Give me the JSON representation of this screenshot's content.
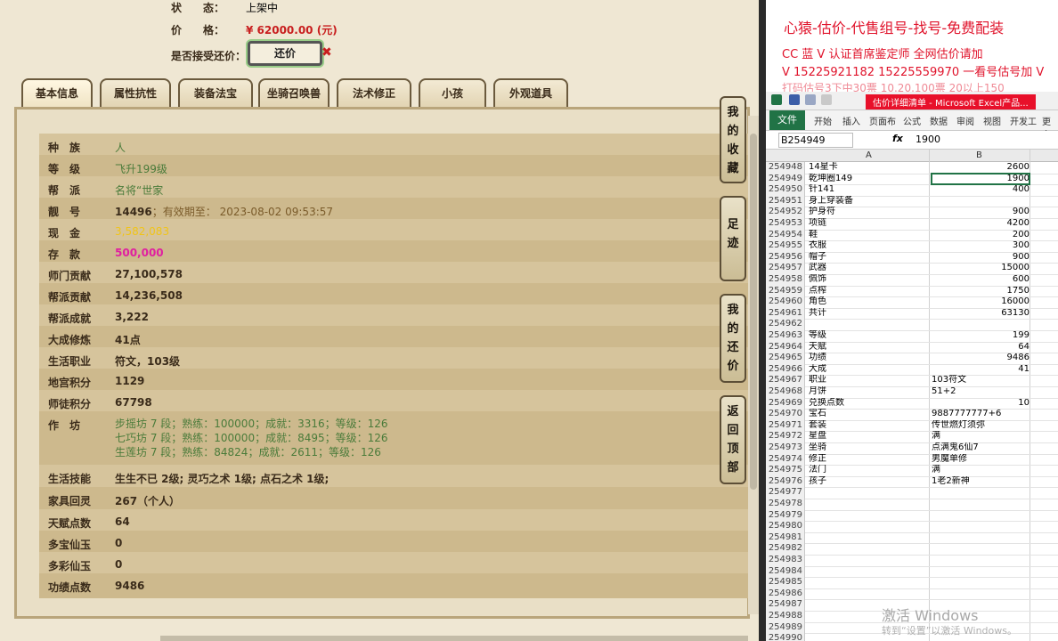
{
  "header": {
    "status_label": "状　　态：",
    "status_value": "上架中",
    "price_label": "价　　格：",
    "price_value": "¥ 62000.00 (元)",
    "bargain_label": "是否接受还价：",
    "bargain_button": "还价",
    "bargain_x": "✖"
  },
  "tabs": [
    "基本信息",
    "属性抗性",
    "装备法宝",
    "坐骑召唤兽",
    "法术修正",
    "小孩",
    "外观道具"
  ],
  "side_buttons": [
    "我的收藏",
    "足迹",
    "我的还价",
    "返回顶部"
  ],
  "rows": [
    {
      "label": "种　族",
      "value": "人"
    },
    {
      "label": "等　级",
      "value": "飞升199级"
    },
    {
      "label": "帮　派",
      "value": "名将“世家"
    },
    {
      "label": "靓　号",
      "value": "14496",
      "extra": "；有效期至：  2023-08-02 09:53:57"
    },
    {
      "label": "现　金",
      "value": "3,582,083"
    },
    {
      "label": "存　款",
      "value": "500,000"
    },
    {
      "label": "师门贡献",
      "value": "27,100,578"
    },
    {
      "label": "帮派贡献",
      "value": "14,236,508"
    },
    {
      "label": "帮派成就",
      "value": "3,222"
    },
    {
      "label": "大成修炼",
      "value": "41点"
    },
    {
      "label": "生活职业",
      "value": "符文，103级"
    },
    {
      "label": "地宫积分",
      "value": "1129"
    },
    {
      "label": "师徒积分",
      "value": "67798"
    },
    {
      "label": "作　坊",
      "lines": [
        "步摇坊 7 段；熟练：100000；成就：3316；等级：126",
        "七巧坊 7 段；熟练：100000；成就：8495；等级：126",
        "生莲坊 7 段；熟练：84824；成就：2611；等级：126"
      ]
    },
    {
      "label": "生活技能",
      "value": "生生不已 2级; 灵巧之术 1级; 点石之术 1级;"
    },
    {
      "label": "家具回灵",
      "value": "267（个人）"
    },
    {
      "label": "天赋点数",
      "value": "64"
    },
    {
      "label": "多宝仙玉",
      "value": "0"
    },
    {
      "label": "多彩仙玉",
      "value": "0"
    },
    {
      "label": "功绩点数",
      "value": "9486"
    }
  ],
  "overlay": {
    "title": "心猿-估价-代售组号-找号-免费配装",
    "line1": "CC 蓝 V 认证首席鉴定师 全网估价请加",
    "line2": "V 15225921182  15225559970 一看号估号加 V",
    "line3": "打码估号3下中30票  10.20.100票  20以上150"
  },
  "excel": {
    "window_title": "估价详细清单 - Microsoft Excel产品...",
    "ribbon_tabs": [
      "文件",
      "开始",
      "插入",
      "页面布",
      "公式",
      "数据",
      "审阅",
      "视图",
      "开发工",
      "更多"
    ],
    "namebox": "B254949",
    "fx": "fx",
    "formula_value": "1900",
    "col_a": "A",
    "col_b": "B",
    "rows": [
      {
        "n": "254948",
        "a": "14星卡",
        "b": "2600",
        "num": true
      },
      {
        "n": "254949",
        "a": "乾坤圈149",
        "b": "1900",
        "num": true
      },
      {
        "n": "254950",
        "a": "针141",
        "b": "400",
        "num": true
      },
      {
        "n": "254951",
        "a": "身上穿装备",
        "b": ""
      },
      {
        "n": "254952",
        "a": "护身符",
        "b": "900",
        "num": true
      },
      {
        "n": "254953",
        "a": "项链",
        "b": "4200",
        "num": true
      },
      {
        "n": "254954",
        "a": "鞋",
        "b": "200",
        "num": true
      },
      {
        "n": "254955",
        "a": "衣服",
        "b": "300",
        "num": true
      },
      {
        "n": "254956",
        "a": "帽子",
        "b": "900",
        "num": true
      },
      {
        "n": "254957",
        "a": "武器",
        "b": "15000",
        "num": true
      },
      {
        "n": "254958",
        "a": "佩饰",
        "b": "600",
        "num": true
      },
      {
        "n": "254959",
        "a": "点榨",
        "b": "1750",
        "num": true
      },
      {
        "n": "254960",
        "a": "角色",
        "b": "16000",
        "num": true
      },
      {
        "n": "254961",
        "a": "共计",
        "b": "63130",
        "num": true
      },
      {
        "n": "254962",
        "a": "",
        "b": ""
      },
      {
        "n": "254963",
        "a": "等级",
        "b": "199",
        "num": true
      },
      {
        "n": "254964",
        "a": "天赋",
        "b": "64",
        "num": true
      },
      {
        "n": "254965",
        "a": "功绩",
        "b": "9486",
        "num": true
      },
      {
        "n": "254966",
        "a": "大成",
        "b": "41",
        "num": true
      },
      {
        "n": "254967",
        "a": "职业",
        "b": "103符文"
      },
      {
        "n": "254968",
        "a": "月饼",
        "b": "51+2"
      },
      {
        "n": "254969",
        "a": "兑换点数",
        "b": "10",
        "num": true
      },
      {
        "n": "254970",
        "a": "宝石",
        "b": "9887777777+6"
      },
      {
        "n": "254971",
        "a": "套装",
        "b": "传世燃灯须弥"
      },
      {
        "n": "254972",
        "a": "星盘",
        "b": "满"
      },
      {
        "n": "254973",
        "a": "坐骑",
        "b": "点满鬼6仙7"
      },
      {
        "n": "254974",
        "a": "修正",
        "b": "男魔单修"
      },
      {
        "n": "254975",
        "a": "法门",
        "b": "满"
      },
      {
        "n": "254976",
        "a": "孩子",
        "b": "1老2新神"
      },
      {
        "n": "254977",
        "a": "",
        "b": ""
      },
      {
        "n": "254978",
        "a": "",
        "b": ""
      },
      {
        "n": "254979",
        "a": "",
        "b": ""
      },
      {
        "n": "254980",
        "a": "",
        "b": ""
      },
      {
        "n": "254981",
        "a": "",
        "b": ""
      },
      {
        "n": "254982",
        "a": "",
        "b": ""
      },
      {
        "n": "254983",
        "a": "",
        "b": ""
      },
      {
        "n": "254984",
        "a": "",
        "b": ""
      },
      {
        "n": "254985",
        "a": "",
        "b": ""
      },
      {
        "n": "254986",
        "a": "",
        "b": ""
      },
      {
        "n": "254987",
        "a": "",
        "b": ""
      },
      {
        "n": "254988",
        "a": "",
        "b": ""
      },
      {
        "n": "254989",
        "a": "",
        "b": ""
      },
      {
        "n": "254990",
        "a": "",
        "b": ""
      }
    ]
  },
  "watermark": {
    "line1": "激活 Windows",
    "line2": "转到“设置”以激活 Windows。"
  }
}
